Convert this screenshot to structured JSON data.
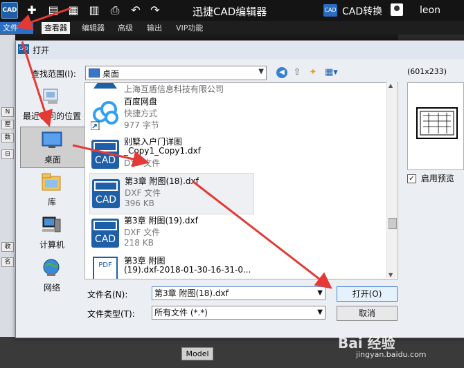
{
  "titlebar": {
    "logo": "CAD",
    "app_title": "迅捷CAD编辑器",
    "cad_logo": "CAD",
    "cad_convert": "CAD转换",
    "username": "leon",
    "quick_access": [
      {
        "icon": "new-icon",
        "glyph": "✚"
      },
      {
        "icon": "open-folder-icon",
        "glyph": "▤"
      },
      {
        "icon": "save-icon",
        "glyph": "▦"
      },
      {
        "icon": "save-as-icon",
        "glyph": "▥"
      },
      {
        "icon": "print-icon",
        "glyph": "⎙"
      },
      {
        "icon": "undo-icon",
        "glyph": "↶"
      },
      {
        "icon": "redo-icon",
        "glyph": "↷"
      }
    ]
  },
  "ribbon_tabs": [
    "文件",
    "查看器",
    "编辑器",
    "高级",
    "输出",
    "VIP功能"
  ],
  "left_panel_marks": [
    "N",
    "厘",
    "数",
    "⊟",
    "收",
    "名"
  ],
  "dialog": {
    "title": "打开",
    "look_in_label": "查找范围(I):",
    "look_in_value": "桌面",
    "places": [
      "最近访问的位置",
      "桌面",
      "库",
      "计算机",
      "网络"
    ],
    "files": [
      {
        "name": "上海互盾信息科技有限公司",
        "name2": "",
        "type": "",
        "size": ""
      },
      {
        "name": "百度网盘",
        "name2": "",
        "type": "快捷方式",
        "size": "977 字节"
      },
      {
        "name": "别墅入户门详图",
        "name2": "_Copy1_Copy1.dxf",
        "type": "DXF 文件",
        "size": ""
      },
      {
        "name": "第3章  附图(18).dxf",
        "name2": "",
        "type": "DXF 文件",
        "size": "396 KB"
      },
      {
        "name": "第3章  附图(19).dxf",
        "name2": "",
        "type": "DXF 文件",
        "size": "218 KB"
      },
      {
        "name": "第3章  附图",
        "name2": "(19).dxf-2018-01-30-16-31-0...",
        "type": "",
        "size": ""
      }
    ],
    "filename_label": "文件名(N):",
    "filename_value": "第3章  附图(18).dxf",
    "filetype_label": "文件类型(T):",
    "filetype_value": "所有文件 (*.*)",
    "open_button": "打开(O)",
    "cancel_button": "取消",
    "preview_size": "(601x233)",
    "enable_preview_label": "启用预览",
    "enable_preview_checked": true
  },
  "model_tab": "Model",
  "watermark": {
    "main": "Bai 经验",
    "sub": "jingyan.baidu.com"
  },
  "colors": {
    "accent": "#2a70c8",
    "arrow": "#e53935",
    "cad_icon": "#1f5fa8"
  }
}
